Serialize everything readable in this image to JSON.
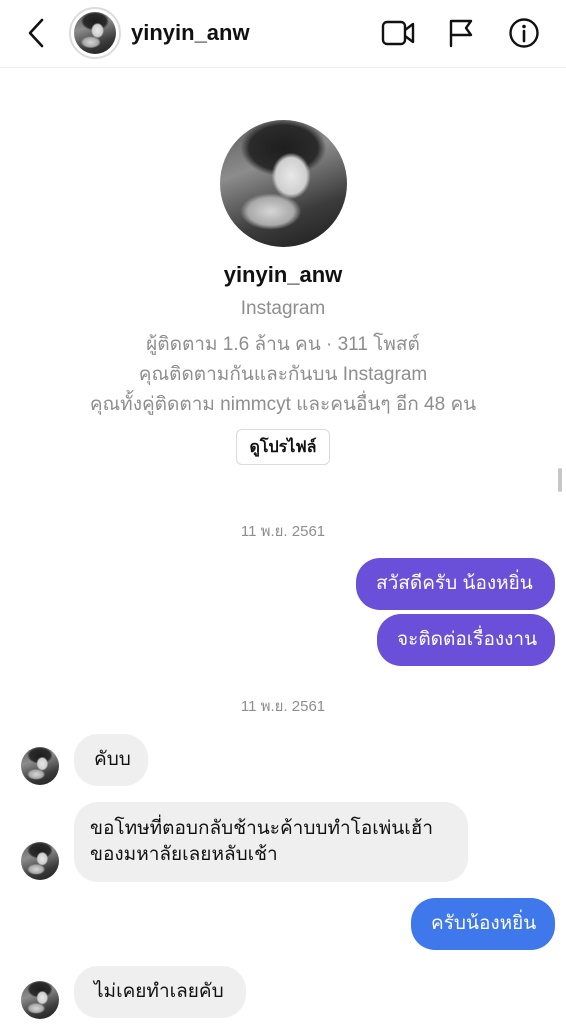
{
  "header": {
    "username": "yinyin_anw",
    "icons": [
      "chevron-left-icon",
      "video-camera-icon",
      "flag-icon",
      "info-icon"
    ]
  },
  "profile": {
    "name": "yinyin_anw",
    "platform": "Instagram",
    "stats": "ผู้ติดตาม 1.6 ล้าน คน · 311 โพสต์",
    "mutual_follow": "คุณติดตามกันและกันบน Instagram",
    "mutual_friends": "คุณทั้งคู่ติดตาม nimmcyt และคนอื่นๆ อีก 48 คน",
    "view_profile_label": "ดูโปรไฟล์"
  },
  "conversation": {
    "timestamps": [
      "11 พ.ย. 2561",
      "11 พ.ย. 2561"
    ],
    "messages": [
      {
        "direction": "sent",
        "text": "สวัสดีครับ น้องหยิ่น",
        "color": "#6a4fd9"
      },
      {
        "direction": "sent",
        "text": "จะติดต่อเรื่องงาน",
        "color": "#6a4fd9"
      },
      {
        "direction": "received",
        "text": "คับบ",
        "color": "#efefef"
      },
      {
        "direction": "received",
        "text": "ขอโทษที่ตอบกลับช้านะค้าบบทำโอเพ่นเฮ้าของมหาลัยเลยหลับเช้า",
        "color": "#efefef"
      },
      {
        "direction": "sent",
        "text": "ครับน้องหยิ่น",
        "color": "#3f78ea"
      },
      {
        "direction": "received",
        "text": "ไม่เคยทำเลยคับ",
        "color": "#efefef"
      }
    ]
  }
}
